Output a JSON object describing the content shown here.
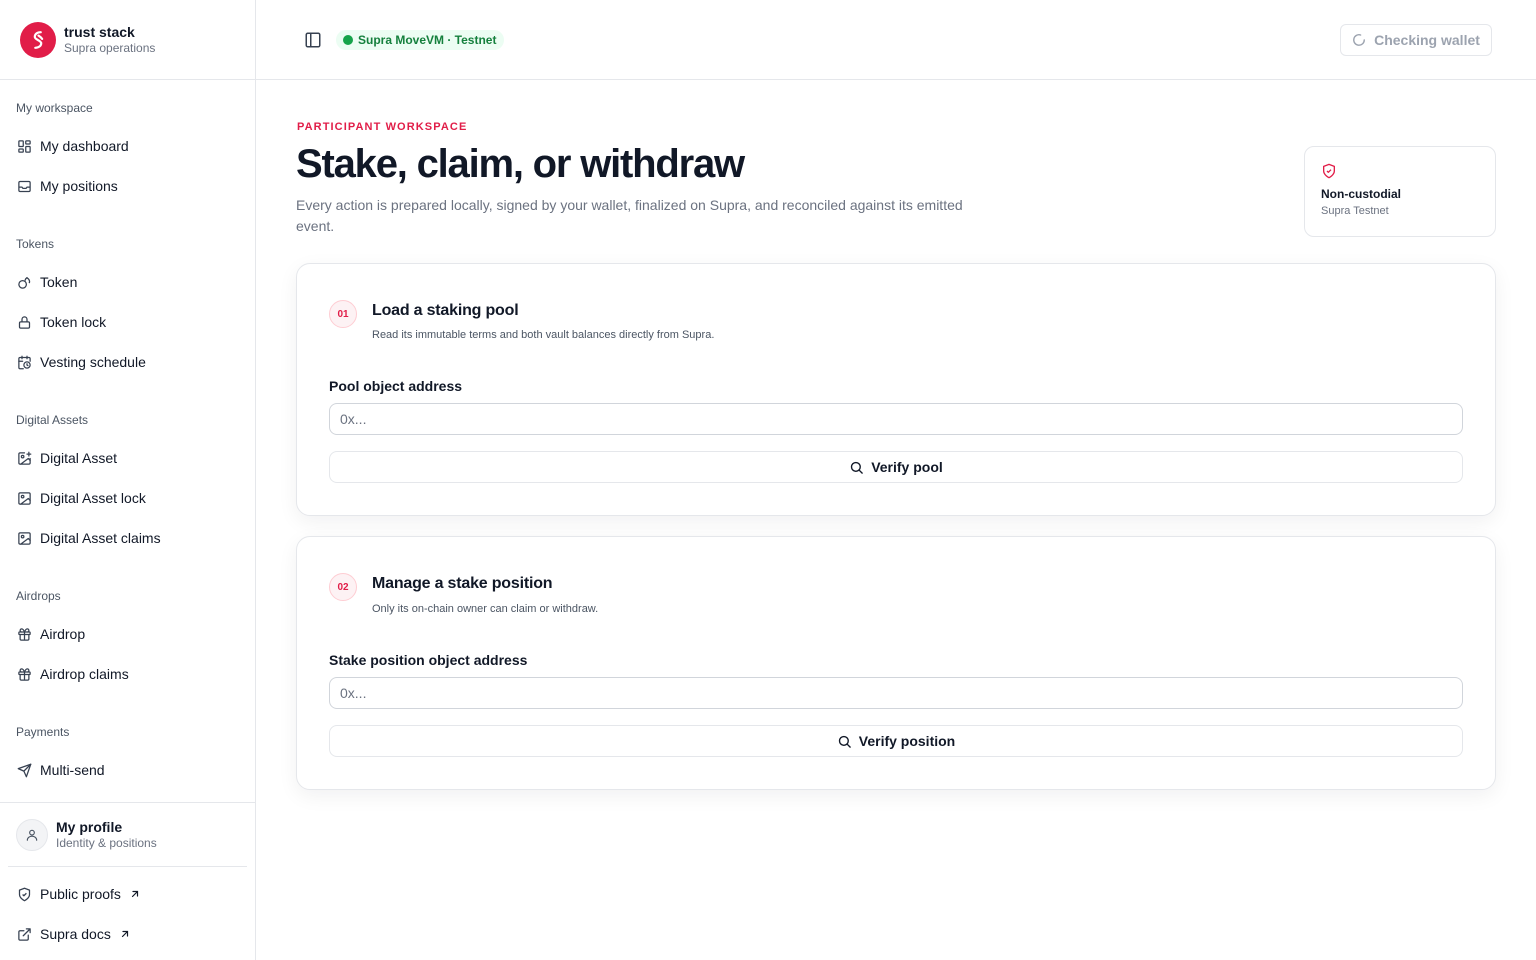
{
  "brand": {
    "name": "trust stack",
    "subtitle": "Supra operations"
  },
  "sidebar": {
    "groups": [
      {
        "label": "My workspace",
        "items": [
          {
            "label": "My dashboard",
            "icon": "dashboard-icon"
          },
          {
            "label": "My positions",
            "icon": "inbox-icon"
          }
        ]
      },
      {
        "label": "Tokens",
        "items": [
          {
            "label": "Token",
            "icon": "coins-icon"
          },
          {
            "label": "Token lock",
            "icon": "lock-icon"
          },
          {
            "label": "Vesting schedule",
            "icon": "calendar-clock-icon"
          }
        ]
      },
      {
        "label": "Digital Assets",
        "items": [
          {
            "label": "Digital Asset",
            "icon": "image-plus-icon"
          },
          {
            "label": "Digital Asset lock",
            "icon": "image-lock-icon"
          },
          {
            "label": "Digital Asset claims",
            "icon": "image-icon"
          }
        ]
      },
      {
        "label": "Airdrops",
        "items": [
          {
            "label": "Airdrop",
            "icon": "gift-icon"
          },
          {
            "label": "Airdrop claims",
            "icon": "gift-icon"
          }
        ]
      },
      {
        "label": "Payments",
        "items": [
          {
            "label": "Multi-send",
            "icon": "send-icon"
          }
        ]
      }
    ],
    "profile": {
      "name": "My profile",
      "subtitle": "Identity & positions"
    },
    "footer_links": [
      {
        "label": "Public proofs",
        "icon": "shield-check-icon"
      },
      {
        "label": "Supra docs",
        "icon": "external-link-icon"
      }
    ]
  },
  "topbar": {
    "network_badge": "Supra MoveVM · Testnet",
    "wallet_button": "Checking wallet"
  },
  "main": {
    "eyebrow": "PARTICIPANT WORKSPACE",
    "title": "Stake, claim, or withdraw",
    "description": "Every action is prepared locally, signed by your wallet, finalized on Supra, and reconciled against its emitted event.",
    "custody_card": {
      "title": "Non-custodial",
      "subtitle": "Supra Testnet"
    },
    "steps": [
      {
        "number": "01",
        "title": "Load a staking pool",
        "subtitle": "Read its immutable terms and both vault balances directly from Supra.",
        "field_label": "Pool object address",
        "placeholder": "0x...",
        "value": "",
        "button": "Verify pool"
      },
      {
        "number": "02",
        "title": "Manage a stake position",
        "subtitle": "Only its on-chain owner can claim or withdraw.",
        "field_label": "Stake position object address",
        "placeholder": "0x...",
        "value": "",
        "button": "Verify position"
      }
    ]
  },
  "colors": {
    "accent": "#e11d48",
    "network_green": "#16a34a",
    "border": "#e5e7eb",
    "muted_text": "#6b7280"
  }
}
